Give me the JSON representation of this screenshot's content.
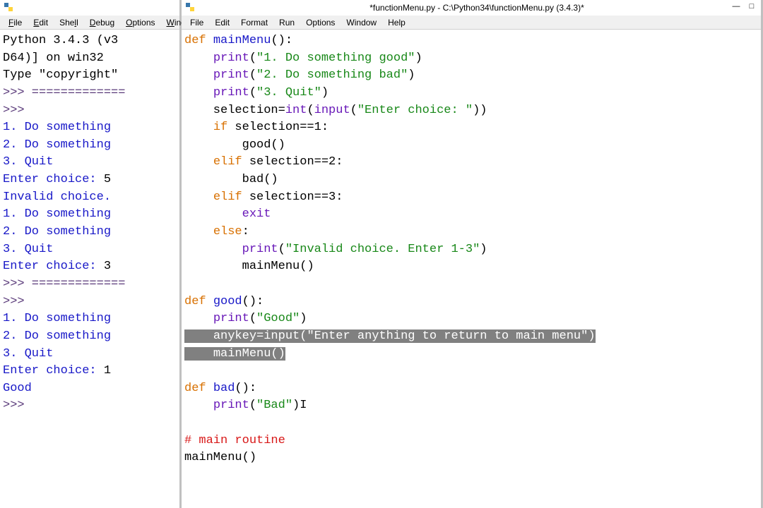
{
  "left": {
    "title": "",
    "menus": [
      "File",
      "Edit",
      "Shell",
      "Debug",
      "Options",
      "Window"
    ],
    "header1": "Python 3.4.3 (v3",
    "header2": "D64)] on win32",
    "header3": "Type \"copyright\"",
    "sep": ">>> =============",
    "prompt_blank1": ">>> ",
    "l_do1a": "1. Do something",
    "l_do2a": "2. Do something",
    "l_quit_a": "3. Quit",
    "l_enter_a": "Enter choice: ",
    "l_enter_a_val": "5",
    "l_invalid": "Invalid choice.",
    "l_do1b": "1. Do something",
    "l_do2b": "2. Do something",
    "l_quit_b": "3. Quit",
    "l_enter_b": "Enter choice: ",
    "l_enter_b_val": "3",
    "sep2": ">>> =============",
    "prompt_blank2": ">>> ",
    "l_do1c": "1. Do something",
    "l_do2c": "2. Do something",
    "l_quit_c": "3. Quit",
    "l_enter_c": "Enter choice: ",
    "l_enter_c_val": "1",
    "l_good": "Good",
    "prompt_blank3": ">>> "
  },
  "right": {
    "title": "*functionMenu.py - C:\\Python34\\functionMenu.py (3.4.3)*",
    "menus": [
      "File",
      "Edit",
      "Format",
      "Run",
      "Options",
      "Window",
      "Help"
    ],
    "code": {
      "def": "def",
      "mainMenu_name": "mainMenu",
      "print_name": "print",
      "int_name": "int",
      "input_name": "input",
      "exit_name": "exit",
      "if_kw": "if",
      "elif_kw": "elif",
      "else_kw": "else",
      "str_1": "\"1. Do something good\"",
      "str_2": "\"2. Do something bad\"",
      "str_3": "\"3. Quit\"",
      "str_enter": "\"Enter choice: \"",
      "sel1": " selection==1:",
      "sel2": " selection==2:",
      "sel3": " selection==3:",
      "good_call": "good()",
      "bad_call": "bad()",
      "str_invalid": "\"Invalid choice. Enter 1-3\"",
      "mainMenu_call": "mainMenu()",
      "good_name": "good",
      "bad_name": "bad",
      "str_good": "\"Good\"",
      "str_bad": "\"Bad\"",
      "anykey_line_pre": "anykey=",
      "str_anykey": "\"Enter anything to return to main menu\"",
      "comment_main": "# main routine",
      "selection_assign_pre": "    selection=",
      "cursor_mark": "I"
    }
  }
}
